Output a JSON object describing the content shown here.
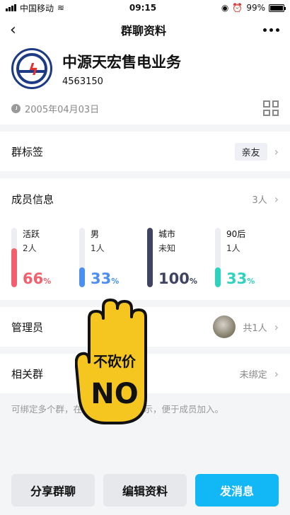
{
  "status": {
    "carrier": "中国移动",
    "time": "09:15",
    "battery": "99%"
  },
  "nav": {
    "title": "群聊资料"
  },
  "group": {
    "name": "中源天宏售电业务",
    "id": "4563150",
    "created": "2005年04月03日"
  },
  "tags_row": {
    "label": "群标签",
    "tag": "亲友"
  },
  "members": {
    "label": "成员信息",
    "count": "3人",
    "stats": [
      {
        "key": "活跃",
        "val": "2人",
        "pct": 66,
        "pct_text": "66",
        "color": "#f1606c"
      },
      {
        "key": "男",
        "val": "1人",
        "pct": 33,
        "pct_text": "33",
        "color": "#4b8ff0"
      },
      {
        "key": "城市",
        "val": "未知",
        "pct": 100,
        "pct_text": "100",
        "color": "#3f4560"
      },
      {
        "key": "90后",
        "val": "1人",
        "pct": 33,
        "pct_text": "33",
        "color": "#2fd3bd"
      }
    ]
  },
  "admin": {
    "label": "管理员",
    "value": "共1人"
  },
  "related": {
    "label": "相关群",
    "value": "未绑定"
  },
  "note": "可绑定多个群，在群资料卡互相展示，便于成员加入。",
  "sticker": {
    "line1": "不砍价",
    "line2": "NO"
  },
  "buttons": {
    "share": "分享群聊",
    "edit": "编辑资料",
    "send": "发消息"
  }
}
